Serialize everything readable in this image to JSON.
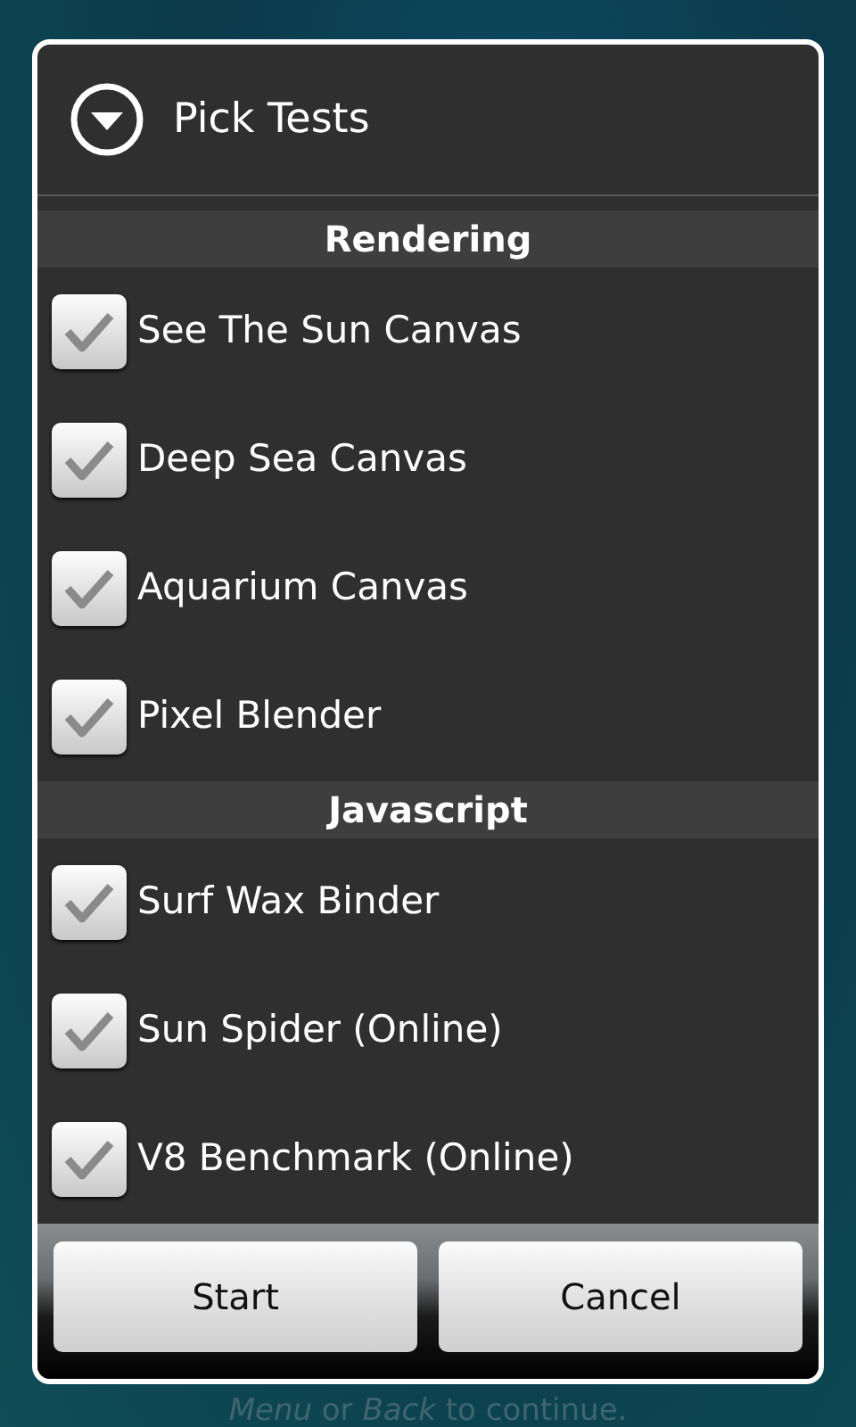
{
  "dialog": {
    "title": "Pick Tests",
    "sections": [
      {
        "header": "Rendering",
        "items": [
          {
            "label": "See The Sun Canvas",
            "checked": true
          },
          {
            "label": "Deep Sea Canvas",
            "checked": true
          },
          {
            "label": "Aquarium Canvas",
            "checked": true
          },
          {
            "label": "Pixel Blender",
            "checked": true
          }
        ]
      },
      {
        "header": "Javascript",
        "items": [
          {
            "label": "Surf Wax Binder",
            "checked": true
          },
          {
            "label": "Sun Spider (Online)",
            "checked": true
          },
          {
            "label": "V8 Benchmark (Online)",
            "checked": true
          }
        ]
      }
    ],
    "buttons": [
      "Start",
      "Cancel"
    ]
  },
  "background": {
    "hint": "*Menu* or *Back* to continue."
  }
}
